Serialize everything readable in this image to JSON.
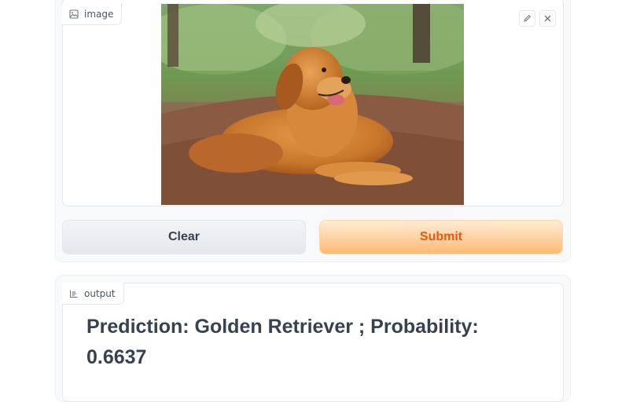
{
  "input": {
    "label": "image",
    "label_icon": "image-icon",
    "tools": {
      "edit_icon": "pencil-icon",
      "close_icon": "close-icon"
    },
    "image_alt": "golden retriever lying on a forest path"
  },
  "actions": {
    "clear_label": "Clear",
    "submit_label": "Submit"
  },
  "output": {
    "label": "output",
    "label_icon": "text-lines-icon",
    "text": "Prediction: Golden Retriever ; Probability: 0.6637"
  },
  "colors": {
    "submit_text": "#ea580c",
    "submit_bg_top": "#ffedd5",
    "submit_bg_bottom": "#fdba74",
    "clear_text": "#374151",
    "output_text": "#374151"
  }
}
